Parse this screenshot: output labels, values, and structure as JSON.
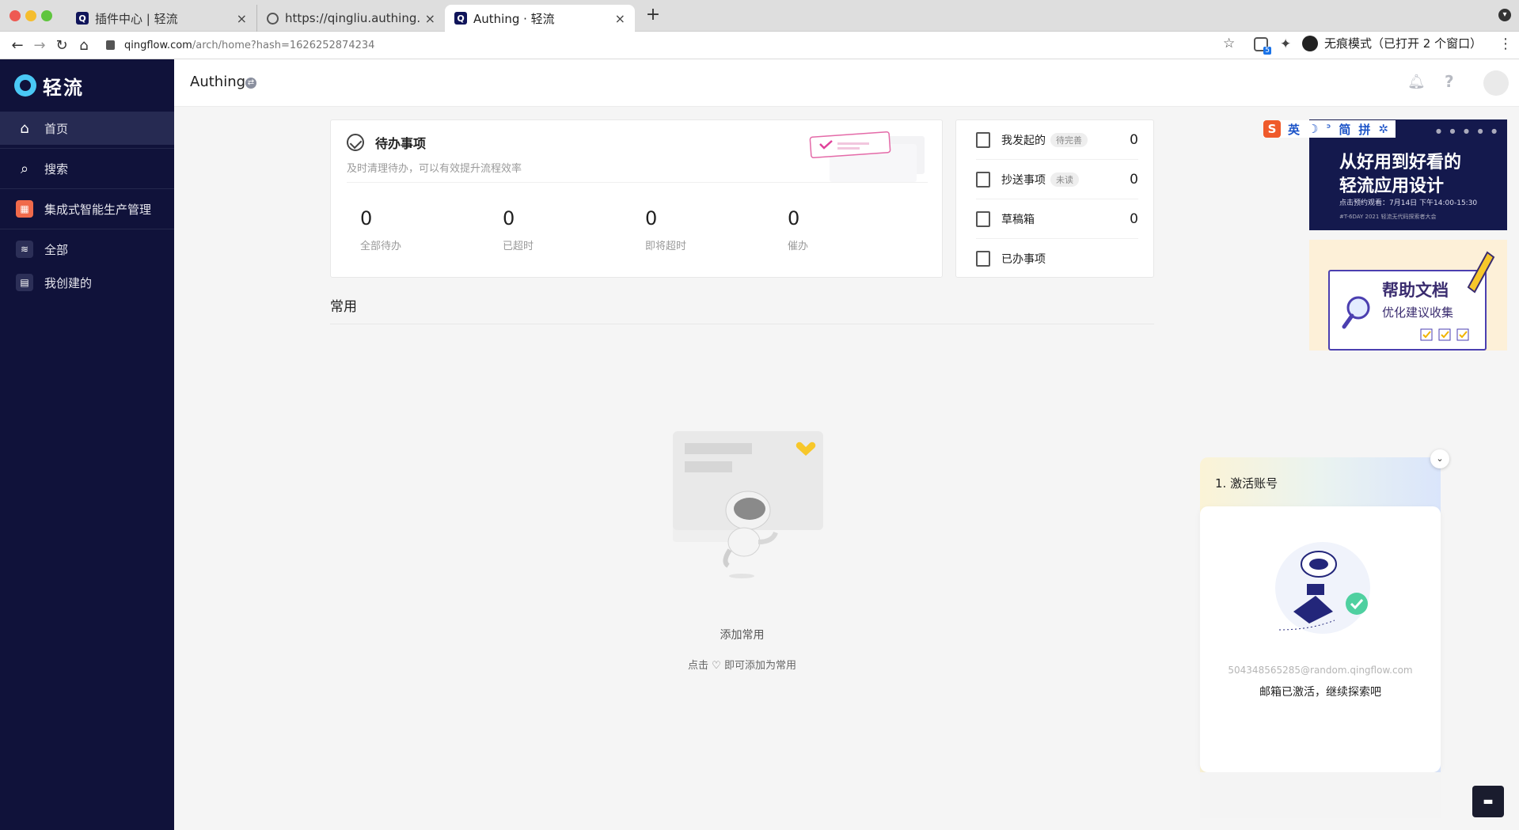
{
  "browser": {
    "tabs": [
      {
        "title": "插件中心 | 轻流",
        "favicon": "qingflow-icon",
        "active": false
      },
      {
        "title": "https://qingliu.authing.c",
        "favicon": "globe-icon",
        "active": false
      },
      {
        "title": "Authing · 轻流",
        "favicon": "qingflow-icon",
        "active": true
      }
    ],
    "close_glyph": "×",
    "new_tab_glyph": "+",
    "url_host": "qingflow.com",
    "url_path": "/arch/home?hash=1626252874234",
    "extension_badge": "5",
    "incognito_label": "无痕模式（已打开 2 个窗口）"
  },
  "sidebar": {
    "brand_name": "轻流",
    "items": [
      {
        "label": "首页",
        "icon": "home-icon",
        "active": true
      },
      {
        "label": "搜索",
        "icon": "search-icon",
        "active": false
      },
      {
        "label": "集成式智能生产管理",
        "icon": "app-icon",
        "active": false
      },
      {
        "label": "全部",
        "icon": "layers-icon",
        "active": false
      },
      {
        "label": "我创建的",
        "icon": "clipboard-icon",
        "active": false
      }
    ]
  },
  "topbar": {
    "workspace_title": "Authing"
  },
  "todo": {
    "title": "待办事项",
    "subtitle": "及时清理待办，可以有效提升流程效率",
    "stats": [
      {
        "value": "0",
        "label": "全部待办"
      },
      {
        "value": "0",
        "label": "已超时"
      },
      {
        "value": "0",
        "label": "即将超时"
      },
      {
        "value": "0",
        "label": "催办"
      }
    ]
  },
  "side_list": [
    {
      "label": "我发起的",
      "tag": "待完善",
      "count": "0",
      "icon": "edit-doc-icon"
    },
    {
      "label": "抄送事项",
      "tag": "未读",
      "count": "0",
      "icon": "inbox-icon"
    },
    {
      "label": "草稿箱",
      "tag": "",
      "count": "0",
      "icon": "draft-icon"
    },
    {
      "label": "已办事项",
      "tag": "",
      "count": "",
      "icon": "checked-box-icon"
    }
  ],
  "common": {
    "section_title": "常用",
    "empty_title": "添加常用",
    "empty_hint": "点击 ♡ 即可添加为常用"
  },
  "banners": {
    "event": {
      "line1": "从好用到好看的",
      "line2": "轻流应用设计",
      "sub": "点击预约观看：7月14日 下午14:00-15:30",
      "tag": "#T-6DAY 2021  轻流无代码探索者大会"
    },
    "help": {
      "line1": "帮助文档",
      "line2": "优化建议收集"
    }
  },
  "ime": {
    "logo": "S",
    "items": [
      "英",
      "☽",
      "ᐣ",
      "简",
      "拼",
      "✲"
    ]
  },
  "activation": {
    "step": "1. 激活账号",
    "email": "504348565285@random.qingflow.com",
    "message": "邮箱已激活，继续探索吧"
  }
}
